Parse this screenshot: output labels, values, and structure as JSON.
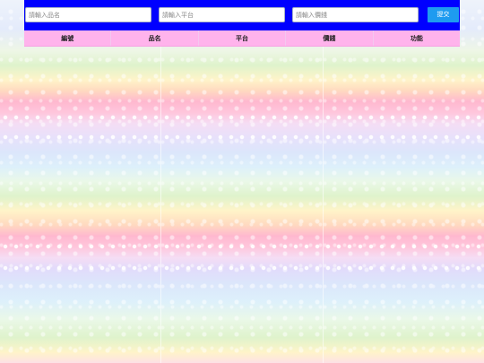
{
  "form": {
    "name_placeholder": "請輸入品名",
    "platform_placeholder": "請輸入平台",
    "price_placeholder": "請輸入價錢",
    "submit_label": "提交"
  },
  "table": {
    "columns": [
      "編號",
      "品名",
      "平台",
      "價錢",
      "功能"
    ]
  },
  "colors": {
    "form_bar": "#0000ff",
    "submit_button": "#1e9bf0",
    "table_header": "#ffb3ec"
  }
}
